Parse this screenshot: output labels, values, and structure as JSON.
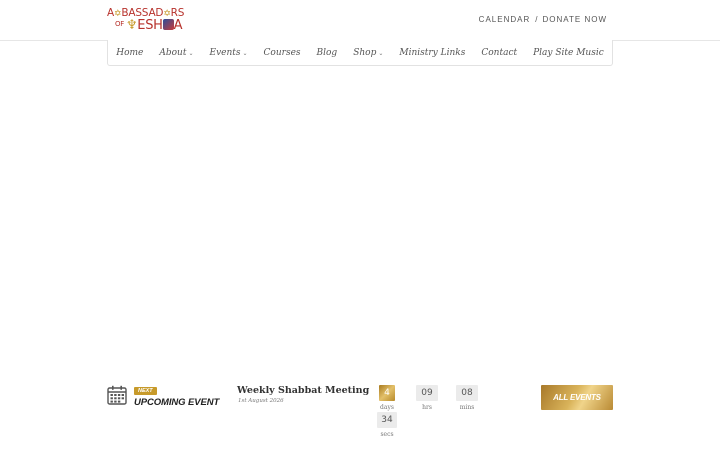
{
  "logo": {
    "line1": "A",
    "line1_mid": "BASSAD",
    "line1_end": "RS",
    "line2_of": "OF",
    "line2_a": "ESH",
    "line2_b": "A"
  },
  "toplinks": {
    "calendar": "CALENDAR",
    "separator": "/",
    "donate": "DONATE NOW"
  },
  "nav": {
    "items": [
      {
        "label": "Home",
        "dropdown": false
      },
      {
        "label": "About",
        "dropdown": true
      },
      {
        "label": "Events",
        "dropdown": true
      },
      {
        "label": "Courses",
        "dropdown": false
      },
      {
        "label": "Blog",
        "dropdown": false
      },
      {
        "label": "Shop",
        "dropdown": true
      },
      {
        "label": "Ministry Links",
        "dropdown": false
      },
      {
        "label": "Contact",
        "dropdown": false
      },
      {
        "label": "Play Site Music",
        "dropdown": false
      }
    ],
    "caret": "⌄"
  },
  "upcoming": {
    "badge": "NEXT",
    "label": "UPCOMING EVENT",
    "event_title": "Weekly Shabbat Meeting",
    "event_date": "1st August 2026",
    "countdown": {
      "days": "4",
      "days_label": "days",
      "hrs": "09",
      "hrs_label": "hrs",
      "mins": "08",
      "mins_label": "mins",
      "secs": "34",
      "secs_label": "secs"
    },
    "all_events": "ALL EVENTS"
  },
  "colors": {
    "brand_red": "#b7322c",
    "gold": "#c79a2a"
  }
}
